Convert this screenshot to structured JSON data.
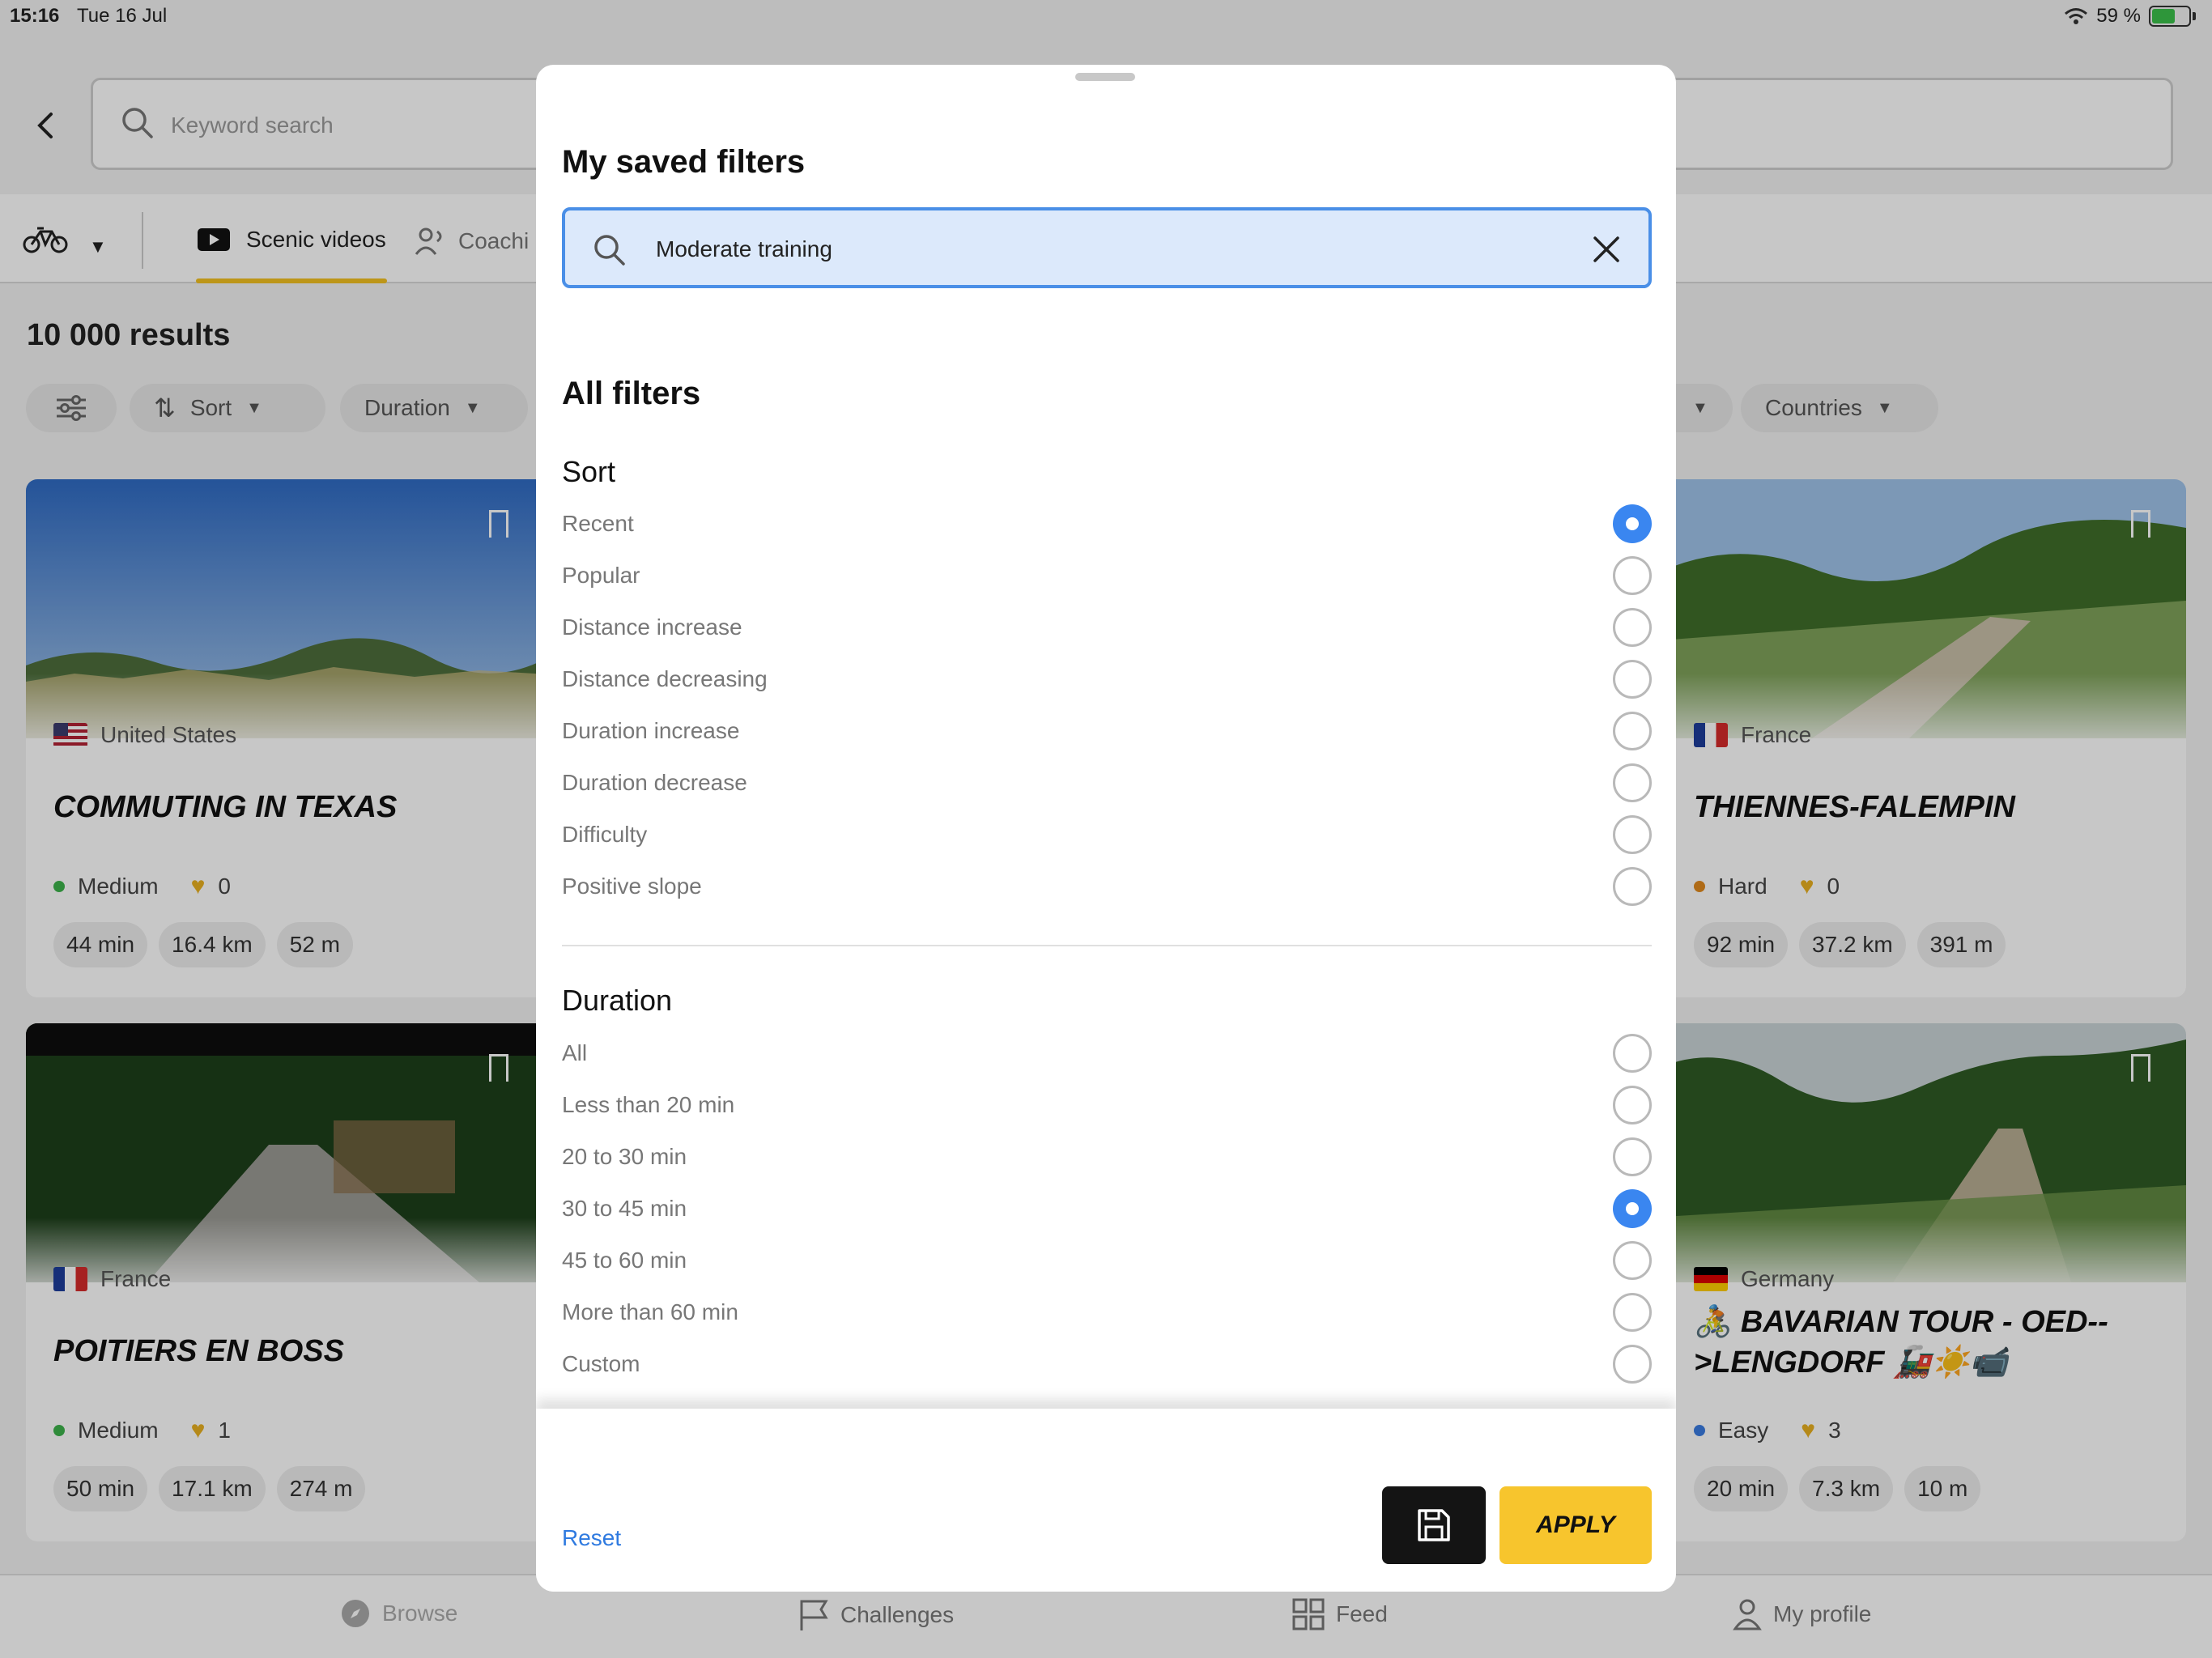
{
  "status_bar": {
    "time": "15:16",
    "date": "Tue 16 Jul",
    "battery": "59 %"
  },
  "header": {
    "search_placeholder": "Keyword search"
  },
  "tabs": {
    "scenic": "Scenic videos",
    "coaching": "Coachi"
  },
  "results_count": "10 000 results",
  "chips": {
    "sort": "Sort",
    "duration": "Duration",
    "countries": "Countries"
  },
  "cards": [
    {
      "country": "United States",
      "title": "COMMUTING IN TEXAS",
      "difficulty": "Medium",
      "likes": "0",
      "duration": "44 min",
      "distance": "16.4 km",
      "elevation": "52 m"
    },
    {
      "country": "France",
      "title": "THIENNES-FALEMPIN",
      "difficulty": "Hard",
      "likes": "0",
      "duration": "92 min",
      "distance": "37.2 km",
      "elevation": "391 m"
    },
    {
      "country": "France",
      "title": "POITIERS EN BOSS",
      "difficulty": "Medium",
      "likes": "1",
      "duration": "50 min",
      "distance": "17.1 km",
      "elevation": "274 m"
    },
    {
      "country": "Germany",
      "title": "🚴 BAVARIAN TOUR - OED-->LENGDORF 🚂☀️📹",
      "difficulty": "Easy",
      "likes": "3",
      "duration": "20 min",
      "distance": "7.3 km",
      "elevation": "10 m"
    }
  ],
  "difficulty_colors": {
    "Medium": "#3db24b",
    "Hard": "#e08a1e",
    "Easy": "#3a7be0"
  },
  "bottom_nav": {
    "browse": "Browse",
    "challenges": "Challenges",
    "feed": "Feed",
    "profile": "My profile"
  },
  "modal": {
    "saved_title": "My saved filters",
    "saved_value": "Moderate training",
    "all_filters_title": "All filters",
    "sort": {
      "title": "Sort",
      "options": [
        "Recent",
        "Popular",
        "Distance increase",
        "Distance decreasing",
        "Duration increase",
        "Duration decrease",
        "Difficulty",
        "Positive slope"
      ],
      "selected": "Recent"
    },
    "duration": {
      "title": "Duration",
      "options": [
        "All",
        "Less than 20 min",
        "20 to 30 min",
        "30 to 45 min",
        "45 to 60 min",
        "More than 60 min",
        "Custom"
      ],
      "selected": "30 to 45 min"
    },
    "reset_label": "Reset",
    "apply_label": "APPLY"
  },
  "colors": {
    "accent_yellow": "#f7c52d",
    "accent_blue": "#3a86f0",
    "link_blue": "#2f7ae0"
  }
}
